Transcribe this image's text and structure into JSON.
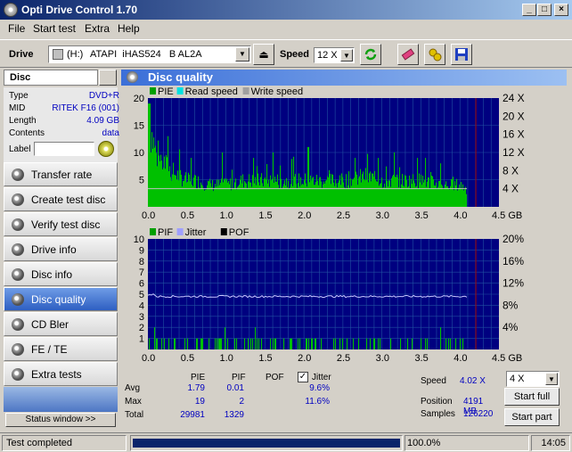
{
  "window": {
    "title": "Opti Drive Control 1.70"
  },
  "menu": [
    "File",
    "Start test",
    "Extra",
    "Help"
  ],
  "toolbar": {
    "drive_label": "Drive",
    "drive_letter": "(H:)",
    "drive_name": "ATAPI  iHAS524   B AL2A",
    "speed_label": "Speed",
    "speed_value": "12 X"
  },
  "disc": {
    "header": "Disc",
    "rows": [
      {
        "key": "Type",
        "value": "DVD+R"
      },
      {
        "key": "MID",
        "value": "RITEK F16 (001)"
      },
      {
        "key": "Length",
        "value": "4.09 GB"
      },
      {
        "key": "Contents",
        "value": "data"
      }
    ],
    "label_key": "Label"
  },
  "nav": [
    "Transfer rate",
    "Create test disc",
    "Verify test disc",
    "Drive info",
    "Disc info",
    "Disc quality",
    "CD Bler",
    "FE / TE",
    "Extra tests"
  ],
  "nav_active": 5,
  "status_window_label": "Status window >>",
  "panel_title": "Disc quality",
  "chart_data": [
    {
      "type": "bar",
      "legend": [
        "PIE",
        "Read speed",
        "Write speed"
      ],
      "legend_colors": [
        "#00a000",
        "#00e0e0",
        "#a0a0a0"
      ],
      "x_ticks": [
        "0.0",
        "0.5",
        "1.0",
        "1.5",
        "2.0",
        "2.5",
        "3.0",
        "3.5",
        "4.0",
        "4.5 GB"
      ],
      "x_range": [
        0,
        4.5
      ],
      "y_left_ticks": [
        "20",
        "15",
        "10",
        "5"
      ],
      "y_left_range": [
        0,
        20
      ],
      "y_right_ticks": [
        "24 X",
        "20 X",
        "16 X",
        "12 X",
        "8 X",
        "4 X"
      ],
      "y_right_range": [
        0,
        24
      ],
      "data_end_gb": 4.09,
      "read_speed_x": 4.02,
      "pie_avg": 1.79,
      "pie_max": 19,
      "pie_profile": [
        [
          0.0,
          19
        ],
        [
          0.05,
          16
        ],
        [
          0.1,
          12
        ],
        [
          0.2,
          10
        ],
        [
          0.3,
          8
        ],
        [
          0.4,
          7
        ],
        [
          0.5,
          6
        ],
        [
          0.6,
          6
        ],
        [
          0.8,
          5
        ],
        [
          1.0,
          5
        ],
        [
          1.2,
          6
        ],
        [
          1.5,
          6
        ],
        [
          1.8,
          6
        ],
        [
          2.0,
          6
        ],
        [
          2.5,
          6
        ],
        [
          2.8,
          7
        ],
        [
          3.0,
          6
        ],
        [
          3.5,
          6
        ],
        [
          3.8,
          5
        ],
        [
          4.0,
          5
        ],
        [
          4.09,
          4
        ]
      ],
      "pie_spikes": [
        [
          0.25,
          13
        ],
        [
          0.55,
          9
        ],
        [
          0.95,
          10
        ],
        [
          1.35,
          9
        ],
        [
          1.6,
          10
        ],
        [
          2.05,
          11
        ],
        [
          2.65,
          9
        ],
        [
          2.95,
          9
        ],
        [
          3.15,
          10
        ],
        [
          3.45,
          9
        ],
        [
          3.55,
          9
        ],
        [
          3.75,
          8
        ]
      ]
    },
    {
      "type": "bar",
      "legend": [
        "PIF",
        "Jitter",
        "POF"
      ],
      "legend_colors": [
        "#00a000",
        "#a0a0ff",
        "#000000"
      ],
      "x_ticks": [
        "0.0",
        "0.5",
        "1.0",
        "1.5",
        "2.0",
        "2.5",
        "3.0",
        "3.5",
        "4.0",
        "4.5 GB"
      ],
      "x_range": [
        0,
        4.5
      ],
      "y_left_ticks": [
        "10",
        "9",
        "8",
        "7",
        "6",
        "5",
        "4",
        "3",
        "2",
        "1"
      ],
      "y_left_range": [
        0,
        10
      ],
      "y_right_ticks": [
        "20%",
        "16%",
        "12%",
        "8%",
        "4%"
      ],
      "y_right_range": [
        0,
        20
      ],
      "data_end_gb": 4.09,
      "jitter_pct": 9.6,
      "pif_avg": 0.01,
      "pif_max": 2
    }
  ],
  "stats": {
    "headers": [
      "PIE",
      "PIF",
      "POF",
      "Jitter"
    ],
    "jitter_checked": true,
    "rows": [
      {
        "label": "Avg",
        "pie": "1.79",
        "pif": "0.01",
        "pof": "",
        "jitter": "9.6%"
      },
      {
        "label": "Max",
        "pie": "19",
        "pif": "2",
        "pof": "",
        "jitter": "11.6%"
      },
      {
        "label": "Total",
        "pie": "29981",
        "pif": "1329",
        "pof": "",
        "jitter": ""
      }
    ],
    "speed_label": "Speed",
    "speed_value": "4.02 X",
    "position_label": "Position",
    "position_value": "4191 MB",
    "samples_label": "Samples",
    "samples_value": "126220",
    "speed_select": "4 X",
    "start_full_label": "Start full",
    "start_part_label": "Start part"
  },
  "status": {
    "text": "Test completed",
    "progress_pct": 100,
    "progress_label": "100.0%",
    "time": "14:05"
  },
  "colors": {
    "chart_bg": "#000080",
    "grid": "#2050a0",
    "pie": "#00c000",
    "pif": "#00c000",
    "speed_line": "#c0c0c0",
    "end_marker": "#a00000"
  }
}
